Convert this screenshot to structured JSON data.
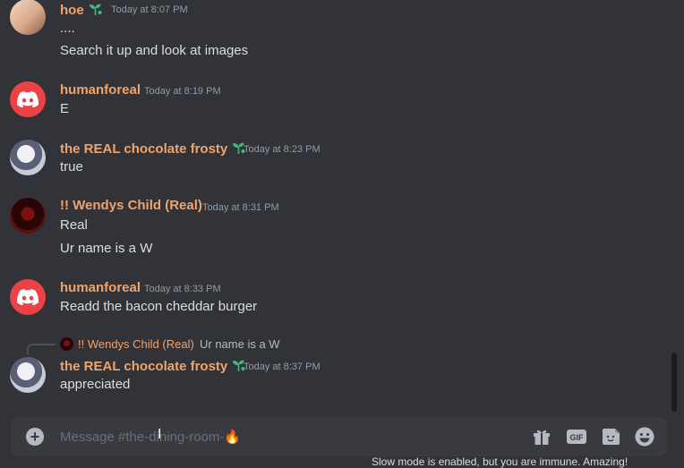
{
  "messages": [
    {
      "author": "hoe",
      "time": "Today at 8:07 PM",
      "avatar": "anime-girl-avatar",
      "badge": "sprout-icon",
      "lines": [
        "....",
        "Search it up and look at images"
      ]
    },
    {
      "author": "humanforeal",
      "time": "Today at 8:19 PM",
      "avatar": "discord-default-avatar",
      "lines": [
        "E"
      ]
    },
    {
      "author": "the REAL chocolate frosty",
      "time": "Today at 8:23 PM",
      "avatar": "anime-boy-avatar",
      "badge": "sprout-icon",
      "lines": [
        "true"
      ]
    },
    {
      "author": "!! Wendys Child (Real)",
      "time": "Today at 8:31 PM",
      "avatar": "dark-red-avatar",
      "lines": [
        "Real",
        "Ur name is a W"
      ]
    },
    {
      "author": "humanforeal",
      "time": "Today at 8:33 PM",
      "avatar": "discord-default-avatar",
      "lines": [
        "Readd the bacon cheddar burger"
      ]
    },
    {
      "author": "the REAL chocolate frosty",
      "time": "Today at 8:37 PM",
      "avatar": "anime-boy-avatar",
      "badge": "sprout-icon",
      "reply": {
        "author": "!! Wendys Child (Real)",
        "text": "Ur name is a W"
      },
      "lines": [
        "appreciated"
      ]
    }
  ],
  "composer": {
    "placeholder": "Message #the-dining-room-🔥",
    "icons": [
      "add-icon",
      "gift-icon",
      "gif-icon",
      "sticker-icon",
      "emoji-icon"
    ]
  },
  "status_bar": {
    "text": "Slow mode is enabled, but you are immune. Amazing!"
  },
  "colors": {
    "background": "#313338",
    "composer": "#383a40",
    "username": "#f0a36b",
    "timestamp": "#949ba4",
    "text": "#dbdee1",
    "discord_red": "#ed4245",
    "badge": "#43b581"
  }
}
